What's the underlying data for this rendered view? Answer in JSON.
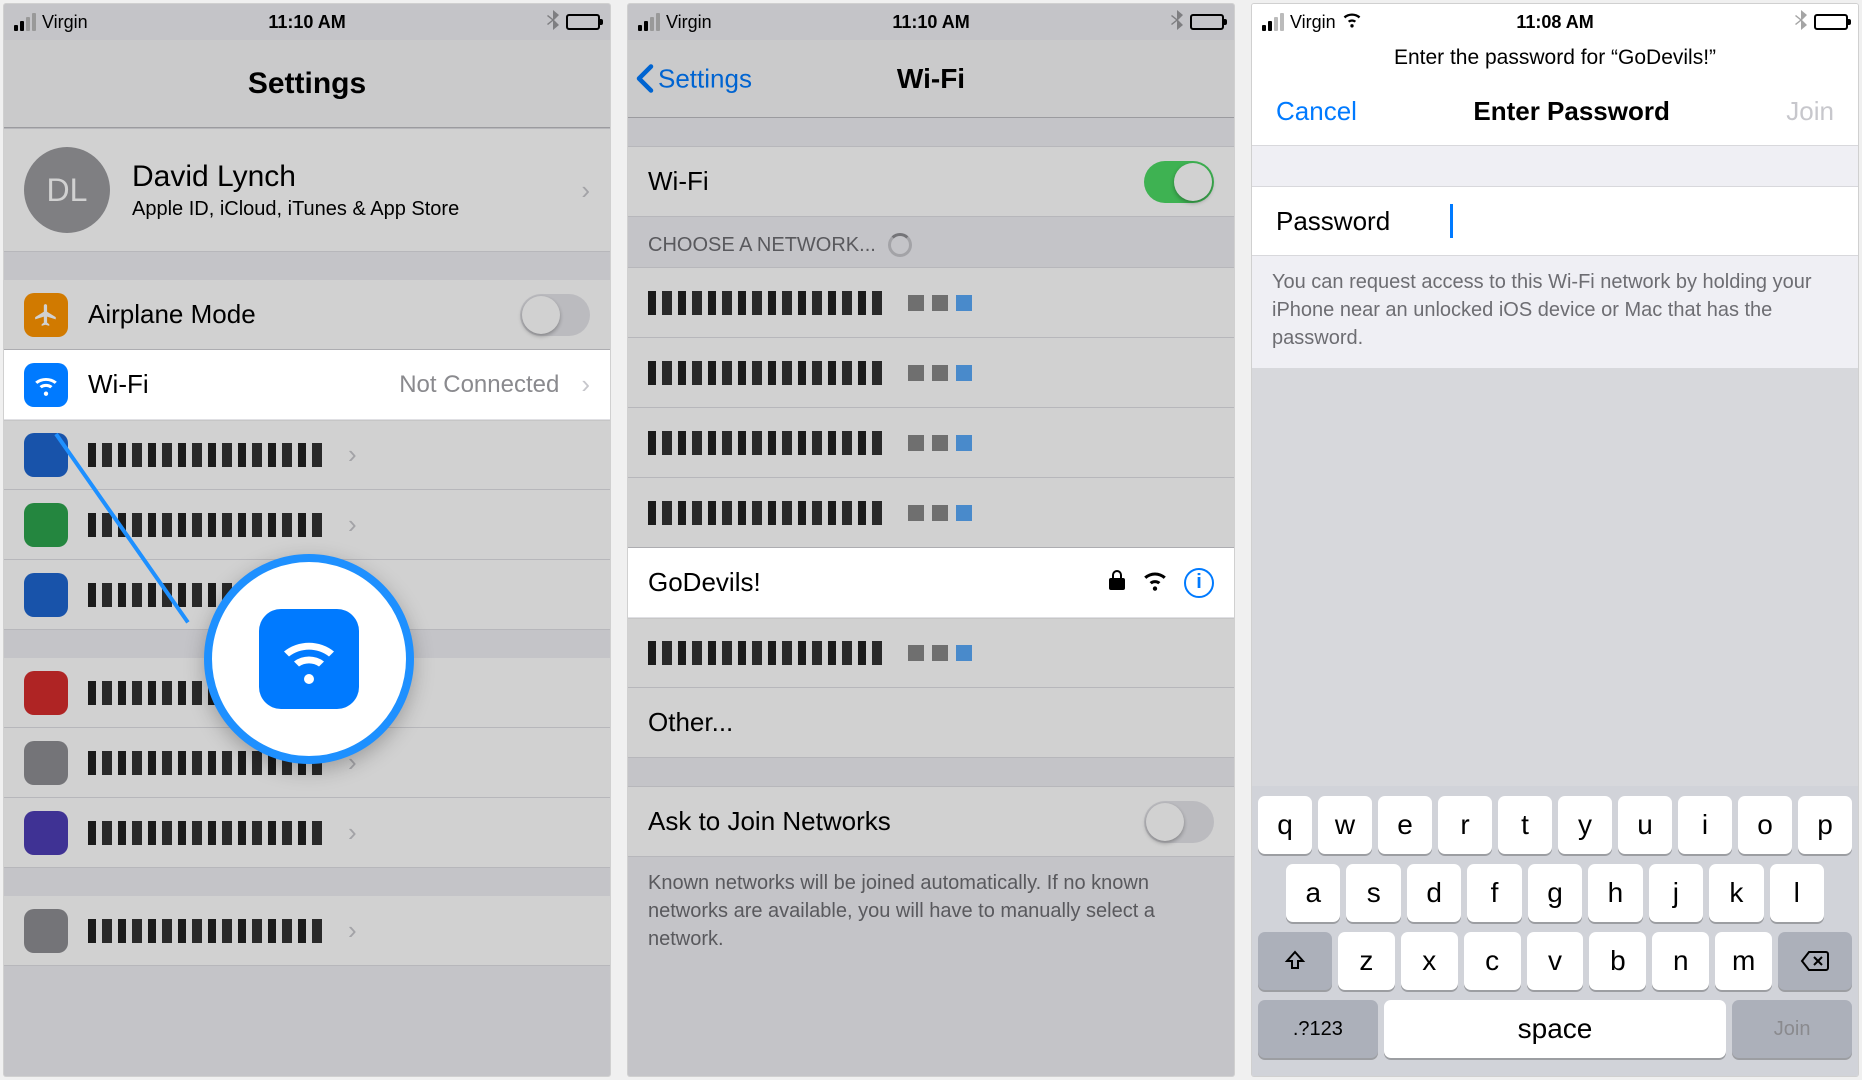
{
  "screen1": {
    "status": {
      "carrier": "Virgin",
      "time": "11:10 AM"
    },
    "title": "Settings",
    "profile": {
      "initials": "DL",
      "name": "David Lynch",
      "sub": "Apple ID, iCloud, iTunes & App Store"
    },
    "airplane": {
      "label": "Airplane Mode"
    },
    "wifi": {
      "label": "Wi-Fi",
      "detail": "Not Connected"
    }
  },
  "screen2": {
    "status": {
      "carrier": "Virgin",
      "time": "11:10 AM"
    },
    "back": "Settings",
    "title": "Wi-Fi",
    "wifi_row": "Wi-Fi",
    "choose": "CHOOSE A NETWORK...",
    "network_highlight": "GoDevils!",
    "other": "Other...",
    "ask": "Ask to Join Networks",
    "ask_footer": "Known networks will be joined automatically. If no known networks are available, you will have to manually select a network."
  },
  "screen3": {
    "status": {
      "carrier": "Virgin",
      "time": "11:08 AM"
    },
    "prompt": "Enter the password for “GoDevils!”",
    "cancel": "Cancel",
    "title": "Enter Password",
    "join": "Join",
    "pwd_label": "Password",
    "hint": "You can request access to this Wi-Fi network by holding your iPhone near an unlocked iOS device or Mac that has the password.",
    "keyboard": {
      "row1": [
        "q",
        "w",
        "e",
        "r",
        "t",
        "y",
        "u",
        "i",
        "o",
        "p"
      ],
      "row2": [
        "a",
        "s",
        "d",
        "f",
        "g",
        "h",
        "j",
        "k",
        "l"
      ],
      "row3": [
        "z",
        "x",
        "c",
        "v",
        "b",
        "n",
        "m"
      ],
      "sym": ".?123",
      "space": "space",
      "join": "Join"
    }
  }
}
